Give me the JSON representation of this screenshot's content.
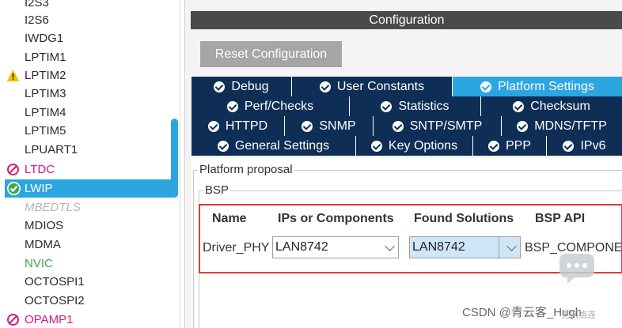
{
  "left_list": {
    "items": [
      {
        "label": "I2S3",
        "style": "normal",
        "icon": ""
      },
      {
        "label": "I2S6",
        "style": "normal",
        "icon": ""
      },
      {
        "label": "IWDG1",
        "style": "normal",
        "icon": ""
      },
      {
        "label": "LPTIM1",
        "style": "normal",
        "icon": ""
      },
      {
        "label": "LPTIM2",
        "style": "normal",
        "icon": "warning-icon"
      },
      {
        "label": "LPTIM3",
        "style": "normal",
        "icon": ""
      },
      {
        "label": "LPTIM4",
        "style": "normal",
        "icon": ""
      },
      {
        "label": "LPTIM5",
        "style": "normal",
        "icon": ""
      },
      {
        "label": "LPUART1",
        "style": "normal",
        "icon": ""
      },
      {
        "label": "LTDC",
        "style": "pink",
        "icon": "blocked-icon"
      },
      {
        "label": "LWIP",
        "style": "selected",
        "icon": "check-circle-icon"
      },
      {
        "label": "MBEDTLS",
        "style": "disabled",
        "icon": ""
      },
      {
        "label": "MDIOS",
        "style": "normal",
        "icon": ""
      },
      {
        "label": "MDMA",
        "style": "normal",
        "icon": ""
      },
      {
        "label": "NVIC",
        "style": "green",
        "icon": ""
      },
      {
        "label": "OCTOSPI1",
        "style": "normal",
        "icon": ""
      },
      {
        "label": "OCTOSPI2",
        "style": "normal",
        "icon": ""
      },
      {
        "label": "OPAMP1",
        "style": "pink",
        "icon": "blocked-icon"
      }
    ]
  },
  "config": {
    "header": "Configuration",
    "reset_label": "Reset Configuration"
  },
  "tabs": {
    "row1": [
      "Debug",
      "User Constants",
      "Platform Settings"
    ],
    "row2": [
      "Perf/Checks",
      "Statistics",
      "Checksum"
    ],
    "row3": [
      "HTTPD",
      "SNMP",
      "SNTP/SMTP",
      "MDNS/TFTP"
    ],
    "row4": [
      "General Settings",
      "Key Options",
      "PPP",
      "IPv6"
    ],
    "active": "Platform Settings"
  },
  "platform": {
    "legend": "Platform proposal",
    "bsp_legend": "BSP",
    "columns": [
      "Name",
      "IPs or Components",
      "Found Solutions",
      "BSP API"
    ],
    "row": {
      "name": "Driver_PHY",
      "ip_value": "LAN8742",
      "solution_value": "LAN8742",
      "bsp_api": "BSP_COMPONE"
    }
  },
  "watermark": {
    "text": "CSDN @青云客_Hugh",
    "sub": "无网络连"
  },
  "colors": {
    "accent": "#2ca6e0",
    "tab_bg": "#0f2e56",
    "header_bg": "#4a4a4a",
    "highlight_border": "#e03a3a",
    "pink": "#d6187e",
    "green": "#3aa84a",
    "warning": "#f5c400"
  }
}
